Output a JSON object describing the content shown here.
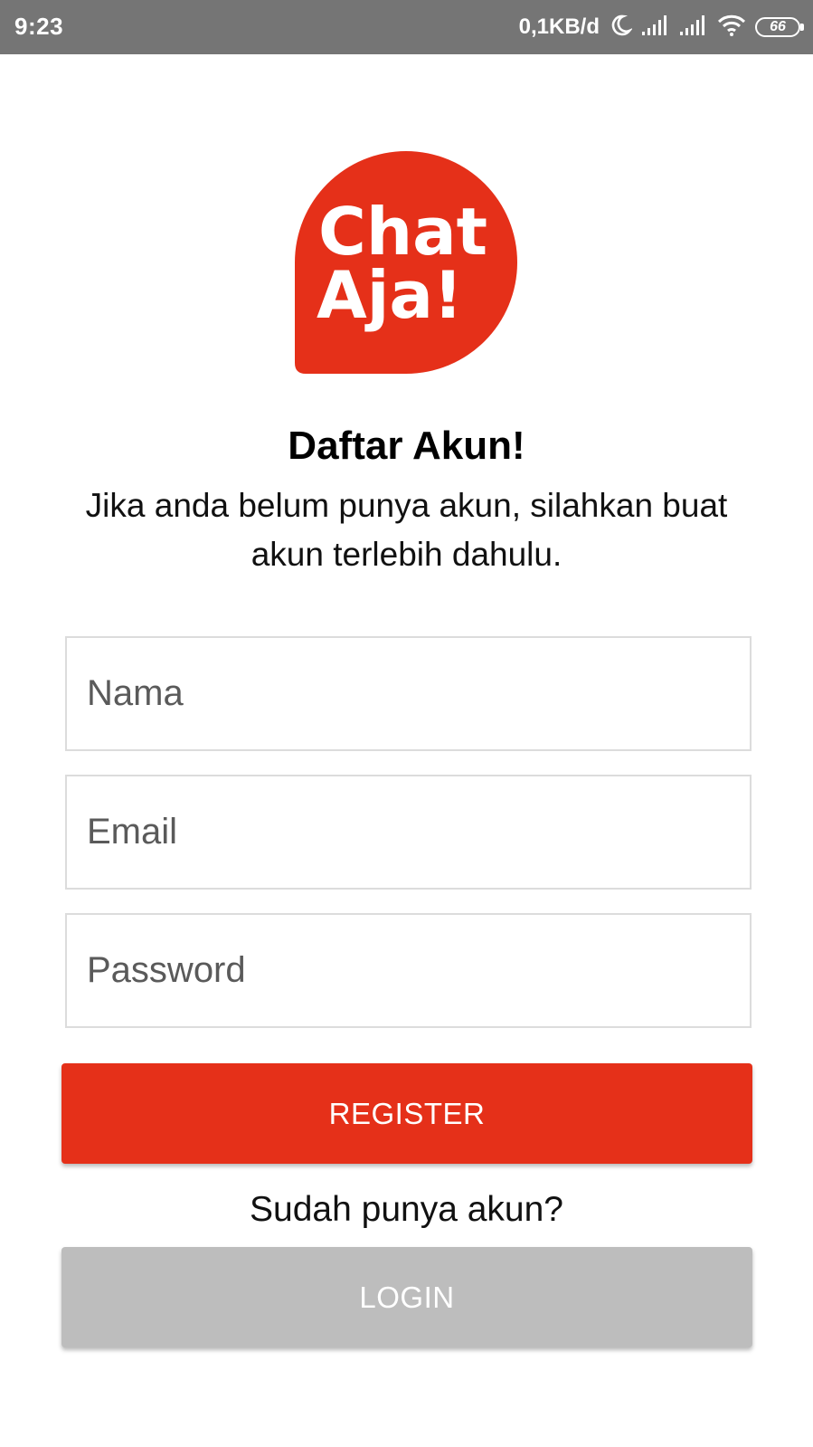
{
  "status_bar": {
    "time": "9:23",
    "net_speed": "0,1KB/d",
    "battery": "66",
    "icons": [
      "moon-icon",
      "signal-icon",
      "signal-icon",
      "wifi-icon",
      "battery-icon"
    ]
  },
  "logo": {
    "line1": "Chat",
    "line2": "Aja!",
    "color": "#e53019"
  },
  "header": {
    "title": "Daftar Akun!",
    "subtitle": "Jika anda belum punya akun, silahkan buat akun terlebih dahulu."
  },
  "form": {
    "name_placeholder": "Nama",
    "name_value": "",
    "email_placeholder": "Email",
    "email_value": "",
    "password_placeholder": "Password",
    "password_value": ""
  },
  "actions": {
    "register_label": "REGISTER",
    "already_text": "Sudah punya akun?",
    "login_label": "LOGIN"
  },
  "colors": {
    "status_bar": "#757575",
    "accent": "#e53019",
    "login_button": "#bdbdbd"
  }
}
